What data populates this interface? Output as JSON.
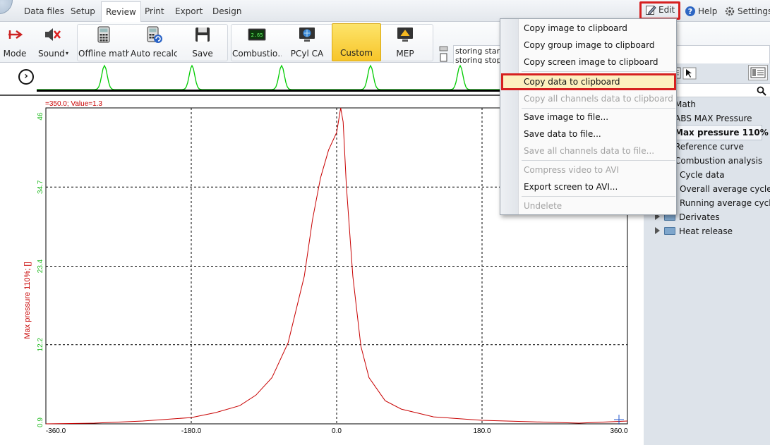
{
  "menubar": {
    "tabs": [
      {
        "label": "Data files",
        "active": false
      },
      {
        "label": "Setup",
        "active": false
      },
      {
        "label": "Review",
        "active": true
      },
      {
        "label": "Print",
        "active": false
      },
      {
        "label": "Export",
        "active": false
      },
      {
        "label": "Design",
        "active": false
      }
    ],
    "right": [
      {
        "label": "Edit",
        "icon": "edit-icon",
        "highlighted": true
      },
      {
        "label": "Help",
        "icon": "help-icon"
      },
      {
        "label": "Settings",
        "icon": "settings-icon"
      }
    ]
  },
  "ribbon": {
    "buttons": [
      {
        "label": "Mode",
        "icon": "mode-icon"
      },
      {
        "label": "Sound",
        "icon": "sound-muted-icon"
      },
      {
        "label": "Offline math",
        "icon": "calculator-icon"
      },
      {
        "label": "Auto recalc",
        "icon": "calculator-refresh-icon"
      },
      {
        "label": "Save",
        "icon": "floppy-disk-icon"
      },
      {
        "label": "Combustio…",
        "icon": "combustion-display-icon"
      },
      {
        "label": "PCyl CA",
        "icon": "monitor-globe-icon"
      },
      {
        "label": "Custom",
        "icon": "",
        "selected": true
      },
      {
        "label": "MEP",
        "icon": "mep-icon"
      }
    ],
    "log_lines": [
      "storing started",
      "storing stopped"
    ]
  },
  "dropdown": {
    "items": [
      {
        "label": "Copy image to clipboard",
        "enabled": true
      },
      {
        "label": "Copy group image to clipboard",
        "enabled": true
      },
      {
        "label": "Copy screen image to clipboard",
        "enabled": true
      },
      {
        "label": "Copy data to clipboard",
        "enabled": true,
        "highlighted": true
      },
      {
        "label": "Copy all channels data to clipboard",
        "enabled": false
      },
      {
        "label": "Save image to file...",
        "enabled": true
      },
      {
        "label": "Save data to file...",
        "enabled": true
      },
      {
        "label": "Save all channels data  to file...",
        "enabled": false
      },
      {
        "label": "Compress video to AVI",
        "enabled": false
      },
      {
        "label": "Export screen to AVI...",
        "enabled": true
      },
      {
        "label": "Undelete",
        "enabled": false
      }
    ]
  },
  "right_panel": {
    "items": [
      {
        "label": "Math",
        "indent": 0
      },
      {
        "label": "ABS MAX Pressure",
        "indent": 0
      },
      {
        "label": "Max pressure 110%",
        "indent": 0,
        "selected": true
      },
      {
        "label": "Reference curve",
        "indent": 0
      },
      {
        "label": "Combustion analysis",
        "indent": 0
      },
      {
        "label": "Cycle data",
        "indent": 1
      },
      {
        "label": "Overall average cycles",
        "indent": 1
      },
      {
        "label": "Running average cycles",
        "indent": 1
      },
      {
        "label": "Derivates",
        "indent": 1,
        "expandable": true
      },
      {
        "label": "Heat release",
        "indent": 1,
        "expandable": true
      }
    ]
  },
  "chart": {
    "cursor_readout": "=350.0; Value=1.3",
    "ylabel": "Max pressure 110%; []",
    "colors": {
      "curve": "#c80000",
      "grid": "#000000",
      "ytick": "#22bb22",
      "overview": "#00cc00"
    }
  },
  "chart_data": {
    "type": "line",
    "xlabel": "",
    "ylabel": "Max pressure 110%; []",
    "xlim": [
      -360,
      360
    ],
    "ylim": [
      0.9,
      46
    ],
    "xticks": [
      "-360.0",
      "-180.0",
      "0.0",
      "180.0",
      "360.0"
    ],
    "yticks": [
      "0.9",
      "12.2",
      "23.4",
      "34.7",
      "46"
    ],
    "grid": true,
    "series": [
      {
        "x": [
          -360,
          -300,
          -240,
          -180,
          -150,
          -120,
          -100,
          -80,
          -60,
          -40,
          -30,
          -20,
          -10,
          0,
          5,
          8,
          12,
          20,
          30,
          40,
          60,
          80,
          120,
          180,
          240,
          300,
          360
        ],
        "y": [
          0.9,
          1.0,
          1.3,
          1.8,
          2.5,
          3.5,
          5.0,
          7.5,
          12.5,
          22,
          30,
          36,
          40,
          42.5,
          46,
          44,
          35,
          22,
          12,
          7.5,
          4.2,
          3.0,
          1.9,
          1.4,
          1.2,
          1.0,
          1.3
        ]
      }
    ]
  }
}
